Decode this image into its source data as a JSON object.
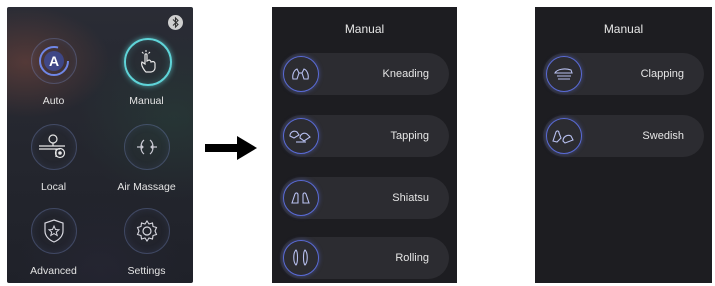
{
  "home": {
    "items": [
      {
        "label": "Auto",
        "icon": "auto-icon",
        "active": false
      },
      {
        "label": "Manual",
        "icon": "hand-touch-icon",
        "active": true
      },
      {
        "label": "Local",
        "icon": "local-massage-icon",
        "active": false
      },
      {
        "label": "Air Massage",
        "icon": "air-massage-icon",
        "active": false
      },
      {
        "label": "Advanced",
        "icon": "shield-star-icon",
        "active": false
      },
      {
        "label": "Settings",
        "icon": "gear-icon",
        "active": false
      }
    ],
    "auto_glyph": "A",
    "status_icon": "bluetooth-icon"
  },
  "manual_page_1": {
    "title": "Manual",
    "items": [
      {
        "label": "Kneading",
        "icon": "kneading-icon"
      },
      {
        "label": "Tapping",
        "icon": "tapping-icon"
      },
      {
        "label": "Shiatsu",
        "icon": "shiatsu-icon"
      },
      {
        "label": "Rolling",
        "icon": "rolling-icon"
      }
    ]
  },
  "manual_page_2": {
    "title": "Manual",
    "items": [
      {
        "label": "Clapping",
        "icon": "clapping-icon"
      },
      {
        "label": "Swedish",
        "icon": "swedish-icon"
      }
    ]
  },
  "colors": {
    "accent_active": "#5fd4d8",
    "icon_ring": "#5a6bd6",
    "panel_bg": "#1d1d21",
    "row_bg": "#2c2c31",
    "text": "#e6e6e6"
  }
}
